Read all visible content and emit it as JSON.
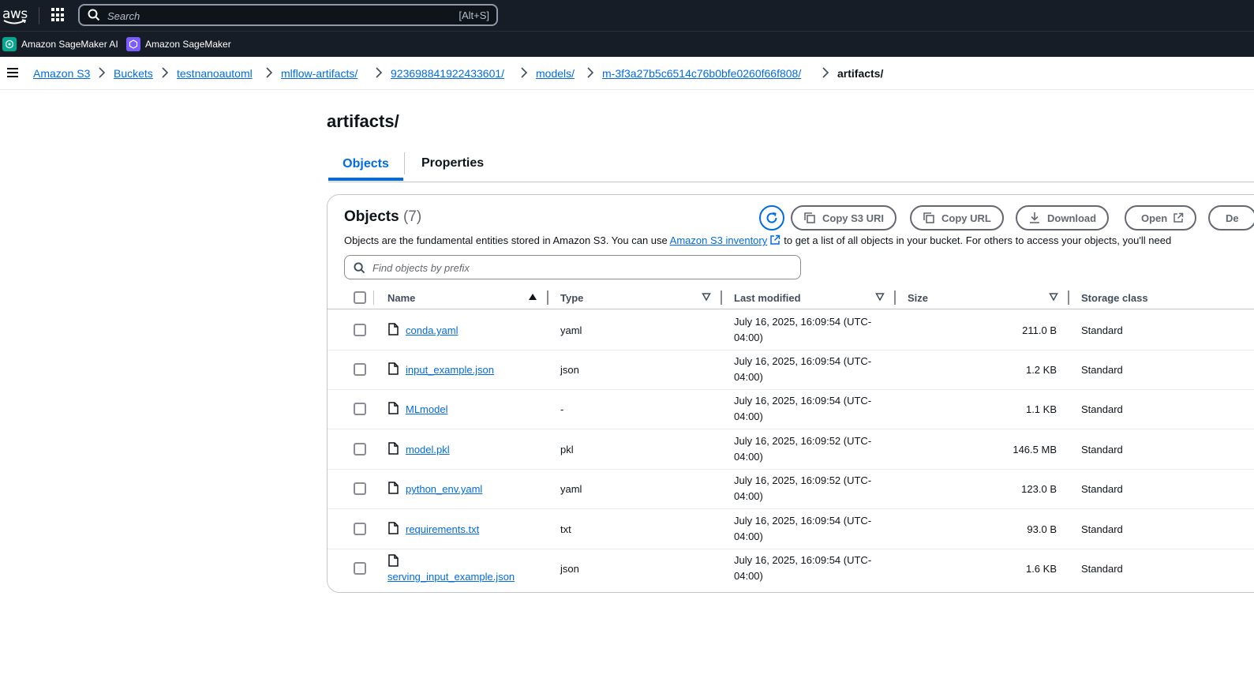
{
  "topnav": {
    "logo_text": "aws",
    "search_placeholder": "Search",
    "search_shortcut": "[Alt+S]"
  },
  "favorites": [
    {
      "label": "Amazon SageMaker AI",
      "color": "#01a88d"
    },
    {
      "label": "Amazon SageMaker",
      "color": "#7d5cff"
    }
  ],
  "breadcrumbs": [
    "Amazon S3",
    "Buckets",
    "testnanoautoml",
    "mlflow-artifacts/",
    "923698841922433601/",
    "models/",
    "m-3f3a27b5c6514c76b0bfe0260f66f808/",
    "artifacts/"
  ],
  "page": {
    "title": "artifacts/",
    "tabs": [
      "Objects",
      "Properties"
    ]
  },
  "objects_panel": {
    "title": "Objects",
    "count": "(7)",
    "description_before": "Objects are the fundamental entities stored in Amazon S3. You can use",
    "description_link": "Amazon S3 inventory",
    "description_after": "to get a list of all objects in your bucket. For others to access your objects, you'll need",
    "buttons": {
      "copy_s3_uri": "Copy S3 URI",
      "copy_url": "Copy URL",
      "download": "Download",
      "open": "Open",
      "delete_partial": "De"
    },
    "filter_placeholder": "Find objects by prefix",
    "columns": [
      "Name",
      "Type",
      "Last modified",
      "Size",
      "Storage class"
    ],
    "rows": [
      {
        "name": "conda.yaml",
        "type": "yaml",
        "last_modified_1": "July 16, 2025, 16:09:54 (UTC-",
        "last_modified_2": "04:00)",
        "size": "211.0 B",
        "storage_class": "Standard"
      },
      {
        "name": "input_example.json",
        "type": "json",
        "last_modified_1": "July 16, 2025, 16:09:54 (UTC-",
        "last_modified_2": "04:00)",
        "size": "1.2 KB",
        "storage_class": "Standard"
      },
      {
        "name": "MLmodel",
        "type": "-",
        "last_modified_1": "July 16, 2025, 16:09:54 (UTC-",
        "last_modified_2": "04:00)",
        "size": "1.1 KB",
        "storage_class": "Standard"
      },
      {
        "name": "model.pkl",
        "type": "pkl",
        "last_modified_1": "July 16, 2025, 16:09:52 (UTC-",
        "last_modified_2": "04:00)",
        "size": "146.5 MB",
        "storage_class": "Standard"
      },
      {
        "name": "python_env.yaml",
        "type": "yaml",
        "last_modified_1": "July 16, 2025, 16:09:52 (UTC-",
        "last_modified_2": "04:00)",
        "size": "123.0 B",
        "storage_class": "Standard"
      },
      {
        "name": "requirements.txt",
        "type": "txt",
        "last_modified_1": "July 16, 2025, 16:09:54 (UTC-",
        "last_modified_2": "04:00)",
        "size": "93.0 B",
        "storage_class": "Standard"
      },
      {
        "name": "serving_input_example.json",
        "type": "json",
        "last_modified_1": "July 16, 2025, 16:09:54 (UTC-",
        "last_modified_2": "04:00)",
        "size": "1.6 KB",
        "storage_class": "Standard"
      }
    ]
  },
  "icons": [
    "grid-icon",
    "search-icon",
    "menu-icon",
    "chevron-right-icon",
    "refresh-icon",
    "copy-icon",
    "download-icon",
    "external-link-icon",
    "file-icon",
    "sort-ascending-icon",
    "sort-descending-icon"
  ],
  "colors": {
    "link": "#006ce0",
    "topbar": "#161d26",
    "text": "#0f141a"
  }
}
